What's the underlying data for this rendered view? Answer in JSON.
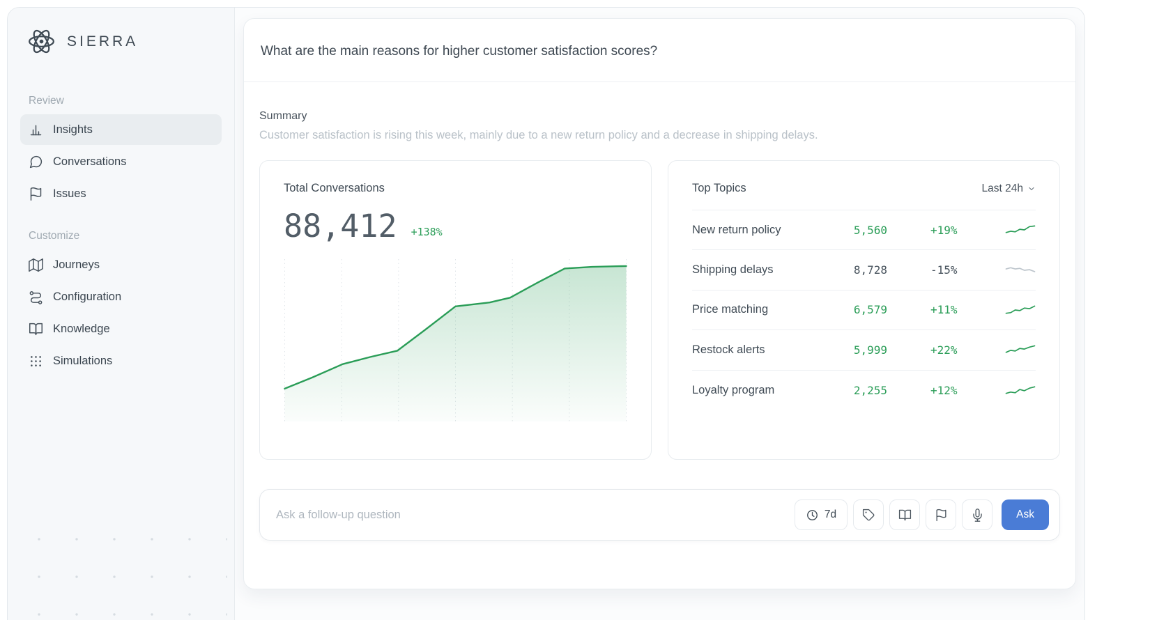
{
  "app": {
    "brand": "SIERRA"
  },
  "sidebar": {
    "sections": [
      {
        "label": "Review",
        "items": [
          {
            "label": "Insights",
            "icon": "bar-chart-icon",
            "active": true
          },
          {
            "label": "Conversations",
            "icon": "chat-bubble-icon",
            "active": false
          },
          {
            "label": "Issues",
            "icon": "flag-icon",
            "active": false
          }
        ]
      },
      {
        "label": "Customize",
        "items": [
          {
            "label": "Journeys",
            "icon": "map-icon",
            "active": false
          },
          {
            "label": "Configuration",
            "icon": "route-icon",
            "active": false
          },
          {
            "label": "Knowledge",
            "icon": "book-open-icon",
            "active": false
          },
          {
            "label": "Simulations",
            "icon": "dots-grid-icon",
            "active": false
          }
        ]
      }
    ]
  },
  "header": {
    "question": "What are the main reasons for higher customer satisfaction scores?"
  },
  "summary": {
    "title": "Summary",
    "text": "Customer satisfaction is rising this week, mainly due to a new return policy and a decrease in shipping delays."
  },
  "cards": {
    "total_conversations": {
      "title": "Total Conversations",
      "value": "88,412",
      "change": "+138%"
    },
    "top_topics": {
      "title": "Top Topics",
      "range_label": "Last 24h",
      "rows": [
        {
          "topic": "New return policy",
          "value": "5,560",
          "change": "+19%",
          "positive": true,
          "spark": [
            [
              0,
              12
            ],
            [
              16,
              10
            ],
            [
              32,
              11
            ],
            [
              48,
              7
            ],
            [
              64,
              8
            ],
            [
              82,
              3
            ],
            [
              100,
              2
            ]
          ]
        },
        {
          "topic": "Shipping delays",
          "value": "8,728",
          "change": "-15%",
          "positive": false,
          "spark": [
            [
              0,
              6
            ],
            [
              16,
              4
            ],
            [
              32,
              6
            ],
            [
              48,
              5
            ],
            [
              64,
              8
            ],
            [
              82,
              7
            ],
            [
              100,
              10
            ]
          ]
        },
        {
          "topic": "Price matching",
          "value": "6,579",
          "change": "+11%",
          "positive": true,
          "spark": [
            [
              0,
              13
            ],
            [
              16,
              12
            ],
            [
              32,
              8
            ],
            [
              48,
              9
            ],
            [
              64,
              5
            ],
            [
              82,
              6
            ],
            [
              100,
              2
            ]
          ]
        },
        {
          "topic": "Restock alerts",
          "value": "5,999",
          "change": "+22%",
          "positive": true,
          "spark": [
            [
              0,
              12
            ],
            [
              16,
              9
            ],
            [
              32,
              10
            ],
            [
              48,
              6
            ],
            [
              64,
              7
            ],
            [
              82,
              4
            ],
            [
              100,
              2
            ]
          ]
        },
        {
          "topic": "Loyalty program",
          "value": "2,255",
          "change": "+12%",
          "positive": true,
          "spark": [
            [
              0,
              13
            ],
            [
              16,
              11
            ],
            [
              32,
              12
            ],
            [
              48,
              7
            ],
            [
              64,
              9
            ],
            [
              82,
              5
            ],
            [
              100,
              3
            ]
          ]
        }
      ]
    }
  },
  "ask_bar": {
    "placeholder": "Ask a follow-up question",
    "buttons": [
      {
        "name": "time-filter",
        "label": "7d",
        "icon": "clock-icon"
      },
      {
        "name": "tag",
        "icon": "tag-icon"
      },
      {
        "name": "knowledge",
        "icon": "book-open-icon"
      },
      {
        "name": "flag",
        "icon": "flag-icon"
      },
      {
        "name": "mic",
        "icon": "mic-icon"
      },
      {
        "name": "ask",
        "label": "Ask"
      }
    ]
  },
  "colors": {
    "green": "#2a9d57",
    "gray_spark": "#bdc5cc",
    "blue": "#4a7cd6"
  },
  "chart_data": {
    "type": "area",
    "title": "Total Conversations",
    "value_total": 88412,
    "change_pct": "+138%",
    "gridlines": 7,
    "grid_style": "dashed-vertical",
    "legend": "none",
    "points": [
      [
        0,
        81
      ],
      [
        8,
        74
      ],
      [
        17,
        65.5
      ],
      [
        25,
        61
      ],
      [
        33,
        57
      ],
      [
        41,
        44
      ],
      [
        50,
        29
      ],
      [
        54,
        28
      ],
      [
        60,
        26.5
      ],
      [
        66,
        23.5
      ],
      [
        74,
        14
      ],
      [
        82,
        5
      ],
      [
        90,
        4
      ],
      [
        100,
        3.5
      ]
    ]
  }
}
